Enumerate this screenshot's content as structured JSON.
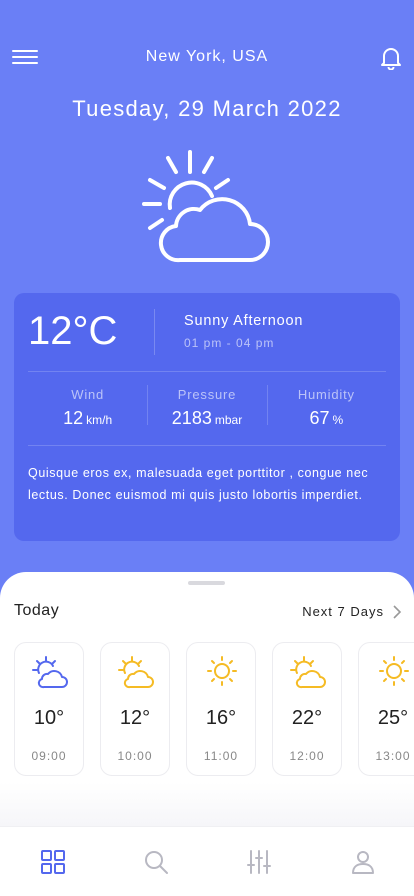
{
  "header": {
    "location": "New York, USA",
    "date": "Tuesday, 29 March 2022"
  },
  "current": {
    "temperature": "12°C",
    "condition": "Sunny Afternoon",
    "time_range": "01 pm - 04 pm",
    "icon": "sun-cloud-icon",
    "stats": {
      "wind": {
        "label": "Wind",
        "value": "12",
        "unit": "km/h"
      },
      "pressure": {
        "label": "Pressure",
        "value": "2183",
        "unit": "mbar"
      },
      "humidity": {
        "label": "Humidity",
        "value": "67",
        "unit": "%"
      }
    },
    "description": "Quisque eros ex, malesuada eget porttitor , congue nec lectus. Donec euismod mi quis justo lobortis imperdiet."
  },
  "forecast": {
    "title": "Today",
    "next_label": "Next 7 Days",
    "hours": [
      {
        "temp": "10°",
        "time": "09:00",
        "icon": "sun-cloud-icon",
        "color": "#5468ee"
      },
      {
        "temp": "12°",
        "time": "10:00",
        "icon": "sun-cloud-icon",
        "color": "#f5bb24"
      },
      {
        "temp": "16°",
        "time": "11:00",
        "icon": "sun-icon",
        "color": "#f5bb24"
      },
      {
        "temp": "22°",
        "time": "12:00",
        "icon": "sun-cloud-icon",
        "color": "#f5bb24"
      },
      {
        "temp": "25°",
        "time": "13:00",
        "icon": "sun-icon",
        "color": "#f5bb24"
      }
    ]
  },
  "tabs": [
    {
      "icon": "grid-icon",
      "active": true
    },
    {
      "icon": "search-icon",
      "active": false
    },
    {
      "icon": "sliders-icon",
      "active": false
    },
    {
      "icon": "user-icon",
      "active": false
    }
  ],
  "colors": {
    "background": "#6a7ff6",
    "card": "#5468ee",
    "accent": "#5468ee",
    "sun": "#f5bb24"
  }
}
